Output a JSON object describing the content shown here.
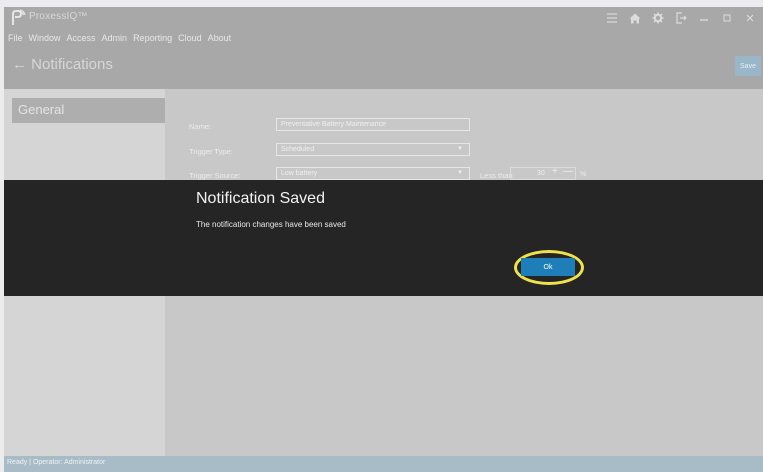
{
  "app": {
    "title": "ProxessIQ™"
  },
  "menu": [
    "File",
    "Window",
    "Access",
    "Admin",
    "Reporting",
    "Cloud",
    "About"
  ],
  "header": {
    "page_title": "← Notifications",
    "save_label": "Save"
  },
  "sidebar": {
    "items": [
      {
        "label": "General"
      }
    ]
  },
  "form": {
    "name_label": "Name:",
    "name_value": "Preventative Battery Maintenance",
    "trigger_type_label": "Trigger Type:",
    "trigger_type_value": "Scheduled",
    "trigger_source_label": "Trigger Source:",
    "trigger_source_value": "Low battery",
    "condition_label": "Less than:",
    "threshold_value": "30",
    "threshold_unit": "%"
  },
  "dialog": {
    "title": "Notification Saved",
    "message": "The notification changes have been saved",
    "ok_label": "Ok"
  },
  "status": {
    "text": "Ready | Operator: Administrator"
  },
  "colors": {
    "accent": "#1e7fb8",
    "highlight_ring": "#f0e24a",
    "dialog_bg": "#252525"
  },
  "icons": [
    "menu-icon",
    "home-icon",
    "gear-icon",
    "logout-icon",
    "minimize-icon",
    "maximize-icon",
    "close-icon"
  ]
}
